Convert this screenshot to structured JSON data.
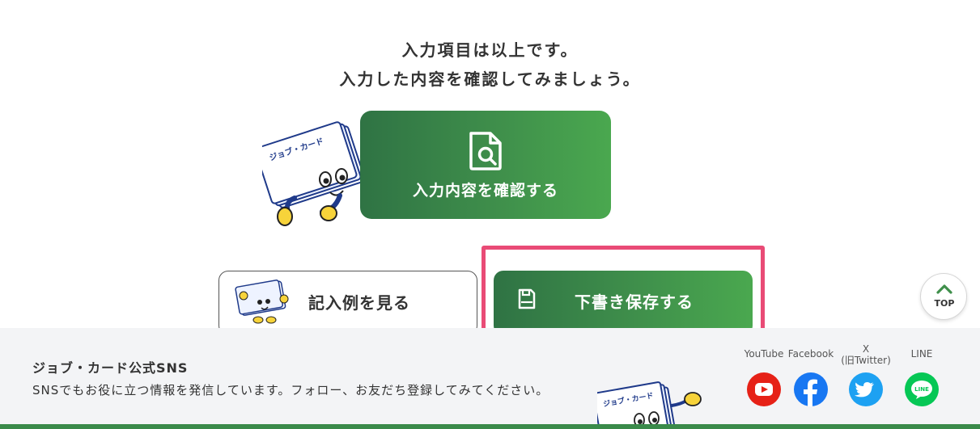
{
  "intro": {
    "line1": "入力項目は以上です。",
    "line2": "入力した内容を確認してみましょう。"
  },
  "actions": {
    "confirm_label": "入力内容を確認する",
    "example_label": "記入例を見る",
    "draft_save_label": "下書き保存する"
  },
  "footer": {
    "sns_title": "ジョブ・カード公式SNS",
    "sns_description": "SNSでもお役に立つ情報を発信しています。フォロー、お友だち登録してみてください。",
    "sns": [
      {
        "label": "YouTube",
        "icon": "youtube-icon",
        "color": "#e62117"
      },
      {
        "label": "Facebook",
        "icon": "facebook-icon",
        "color": "#1877f2"
      },
      {
        "label": "X\n(旧Twitter)",
        "icon": "twitter-icon",
        "color": "#1da1f2"
      },
      {
        "label": "LINE",
        "icon": "line-icon",
        "color": "#06c755"
      }
    ]
  },
  "mascot": {
    "card_text": "ジョブ・カード"
  },
  "top_button": {
    "label": "TOP"
  },
  "colors": {
    "brand_green_dark": "#2f7344",
    "brand_green_light": "#4aa84f",
    "highlight_pink": "#e94b76",
    "footer_bg": "#f3f4f6"
  }
}
